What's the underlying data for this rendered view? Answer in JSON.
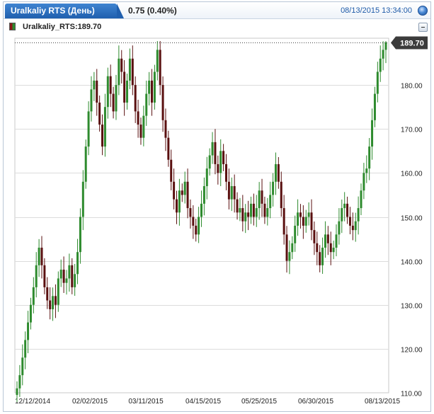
{
  "header": {
    "tab_label": "Uralkaliy  RTS (День)",
    "change": "0.75 (0.40%)",
    "datetime": "08/13/2015 13:34:00"
  },
  "legend": {
    "label": "Uralkaliy_RTS:189.70"
  },
  "colors": {
    "up": "#2e8b2e",
    "down": "#5a1010",
    "grid": "#dcdcdc",
    "tab": "#2a6ab8"
  },
  "chart_data": {
    "type": "candlestick",
    "symbol": "Uralkaliy_RTS",
    "last_price": "189.70",
    "ylim": [
      110,
      190
    ],
    "y_ticks": [
      "110.00",
      "120.00",
      "130.00",
      "140.00",
      "150.00",
      "160.00",
      "170.00",
      "180.00"
    ],
    "x_ticks": [
      "12/12/2014",
      "02/02/2015",
      "03/11/2015",
      "04/15/2015",
      "05/25/2015",
      "06/30/2015",
      "08/13/2015"
    ],
    "grid": "horizontal",
    "series": [
      {
        "values": [
          111,
          114,
          118,
          122,
          126,
          130,
          134,
          139,
          143,
          139,
          134,
          131,
          129,
          132,
          130,
          136,
          138,
          135,
          136,
          139,
          134,
          137,
          142,
          150,
          158,
          166,
          174,
          179,
          181,
          176,
          171,
          166,
          175,
          182,
          178,
          174,
          180,
          186,
          183,
          176,
          181,
          186,
          180,
          174,
          171,
          168,
          173,
          178,
          181,
          176,
          183,
          188,
          180,
          172,
          168,
          163,
          158,
          154,
          151,
          156,
          155,
          158,
          152,
          150,
          148,
          146,
          150,
          153,
          157,
          161,
          164,
          167,
          162,
          160,
          165,
          162,
          158,
          154,
          157,
          154,
          151,
          152,
          149,
          151,
          150,
          153,
          150,
          152,
          156,
          153,
          150,
          152,
          155,
          158,
          162,
          158,
          152,
          146,
          140,
          142,
          144,
          148,
          151,
          150,
          148,
          150,
          151,
          147,
          144,
          142,
          139,
          143,
          146,
          144,
          142,
          143,
          146,
          149,
          152,
          153,
          150,
          148,
          147,
          149,
          152,
          156,
          160,
          161,
          166,
          172,
          178,
          183,
          186,
          188,
          189.7
        ]
      }
    ]
  }
}
